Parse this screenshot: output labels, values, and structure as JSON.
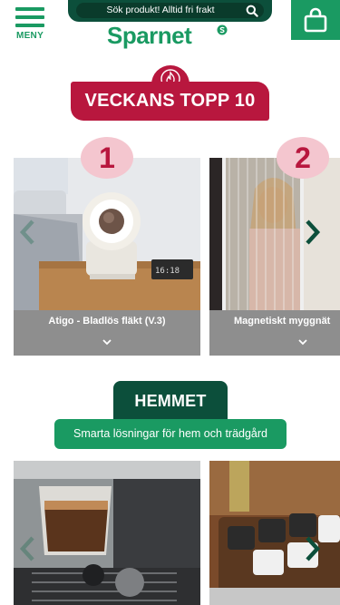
{
  "header": {
    "menu_label": "MENY",
    "search_placeholder": "Sök produkt! Alltid fri frakt",
    "logo_text": "Sparnet",
    "brand_color": "#1a9a62",
    "dark_color": "#0c4f3b"
  },
  "top10": {
    "title": "VECKANS TOPP 10",
    "accent_color": "#b8173e",
    "badge_color": "#f4c6cf",
    "icon": "flame-icon",
    "products": [
      {
        "rank": "1",
        "name": "Atigo - Bladlös fläkt (V.3)"
      },
      {
        "rank": "2",
        "name": "Magnetiskt myggnät"
      }
    ]
  },
  "home": {
    "title": "HEMMET",
    "subtitle": "Smarta lösningar för hem och trädgård"
  }
}
